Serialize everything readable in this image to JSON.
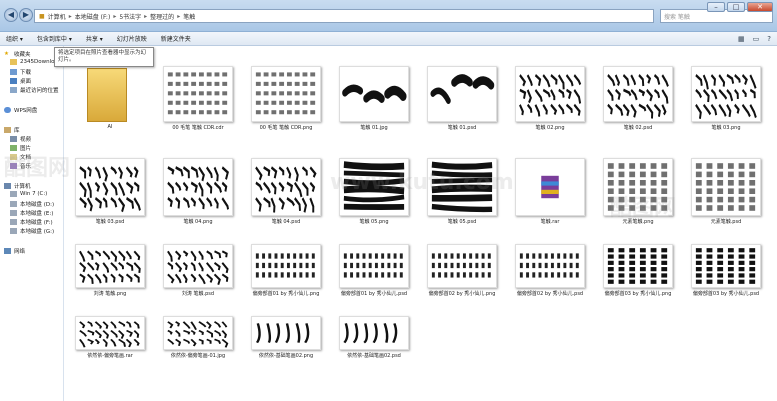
{
  "window": {
    "address": [
      "计算机",
      "本地磁盘 (F:)",
      "5书法字",
      "整理过的",
      "笔触"
    ],
    "search_placeholder": "搜索 笔触",
    "controls": {
      "min": "–",
      "max": "□",
      "close": "✕"
    }
  },
  "toolbar": {
    "items": [
      "组织 ▾",
      "包含到库中 ▾",
      "共享 ▾",
      "幻灯片放映",
      "新建文件夹"
    ]
  },
  "tooltip": "将选定项目在照片查看器中显示为幻灯片。",
  "nav": {
    "favorites_title": "收藏夹",
    "favorites": [
      "2345Downloads",
      "下载",
      "桌面",
      "最近访问的位置"
    ],
    "cloud": "WPS网盘",
    "libraries_title": "库",
    "libraries": [
      "视频",
      "图片",
      "文档",
      "音乐"
    ],
    "computer_title": "计算机",
    "drives": [
      "Win 7 (C:)",
      "本地磁盘 (D:)",
      "本地磁盘 (E:)",
      "本地磁盘 (F:)",
      "本地磁盘 (G:)"
    ],
    "network": "网络"
  },
  "files": [
    {
      "name": "AI",
      "kind": "folder"
    },
    {
      "name": "00 毛笔 笔触 CDR.cdr",
      "kind": "doc"
    },
    {
      "name": "00 毛笔 笔触 CDR.png",
      "kind": "doc"
    },
    {
      "name": "笔触 01.jpg",
      "kind": "brush"
    },
    {
      "name": "笔触 01.psd",
      "kind": "brush"
    },
    {
      "name": "笔触 02.png",
      "kind": "glyphs"
    },
    {
      "name": "笔触 02.psd",
      "kind": "glyphs"
    },
    {
      "name": "笔触 03.png",
      "kind": "glyphs"
    },
    {
      "name": "笔触 03.psd",
      "kind": "glyphs"
    },
    {
      "name": "笔触 04.png",
      "kind": "glyphs"
    },
    {
      "name": "笔触 04.psd",
      "kind": "glyphs"
    },
    {
      "name": "笔触 05.png",
      "kind": "strokes"
    },
    {
      "name": "笔触 05.psd",
      "kind": "strokes"
    },
    {
      "name": "笔触.rar",
      "kind": "rar"
    },
    {
      "name": "元素笔触.png",
      "kind": "dots"
    },
    {
      "name": "元素笔触.psd",
      "kind": "dots"
    },
    {
      "name": "刘涛 笔触.png",
      "kind": "glyphs"
    },
    {
      "name": "刘涛 笔触.psd",
      "kind": "glyphs"
    },
    {
      "name": "偏旁部首01  by 秀小仙儿.png",
      "kind": "rows"
    },
    {
      "name": "偏旁部首01  by 秀小仙儿.psd",
      "kind": "rows"
    },
    {
      "name": "偏旁部首02  by 秀小仙儿.png",
      "kind": "rows"
    },
    {
      "name": "偏旁部首02  by 秀小仙儿.psd",
      "kind": "rows"
    },
    {
      "name": "偏旁部首03  by 秀小仙儿.png",
      "kind": "dense"
    },
    {
      "name": "偏旁部首03  by 秀小仙儿.psd",
      "kind": "dense"
    },
    {
      "name": "依然依-偏旁笔画.rar",
      "kind": "glyphs"
    },
    {
      "name": "依然依-偏旁笔画-01.jpg",
      "kind": "glyphs"
    },
    {
      "name": "依然依-基础笔画02.png",
      "kind": "curves"
    },
    {
      "name": "依然依-基础笔画02.psd",
      "kind": "curves"
    }
  ],
  "watermarks": [
    "酷图网",
    "www.kutu.com"
  ]
}
